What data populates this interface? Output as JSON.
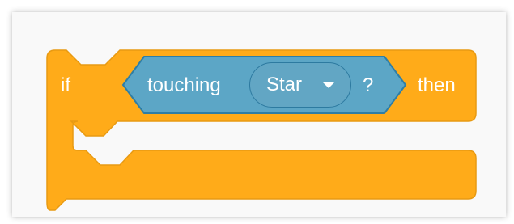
{
  "block": {
    "if_label": "if",
    "condition_label": "touching",
    "target_value": "Star",
    "question_mark": "?",
    "then_label": "then"
  },
  "colors": {
    "control_block": "#ffab19",
    "control_block_border": "#e89a12",
    "sensing_block": "#5ca6c6",
    "sensing_block_border": "#2e7ea6",
    "dropdown": "#62a6c4",
    "text": "#ffffff"
  },
  "icons": {
    "dropdown": "triangle-down-icon"
  }
}
